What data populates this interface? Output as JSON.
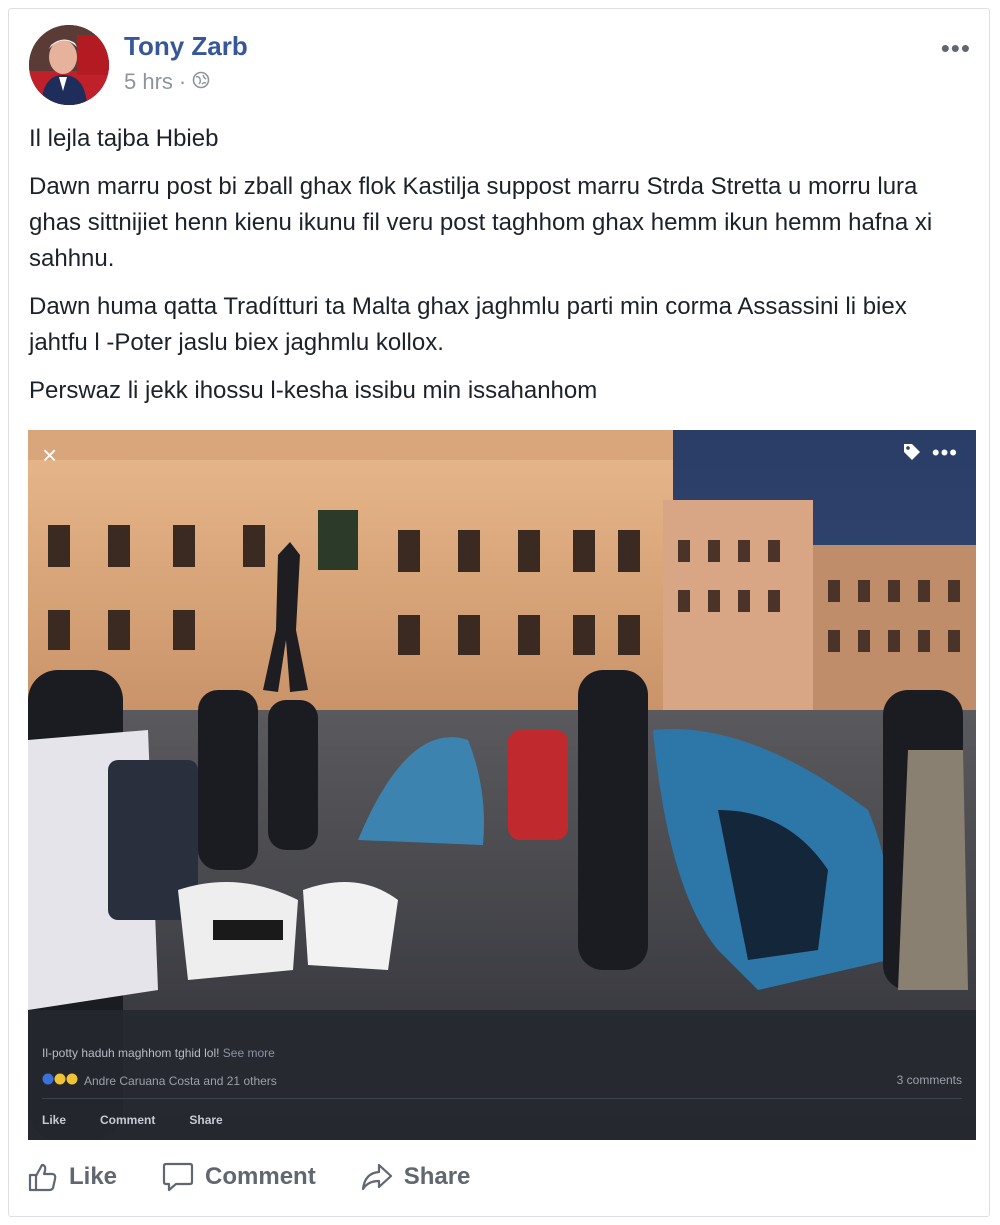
{
  "post": {
    "author": "Tony Zarb",
    "timestamp": "5 hrs",
    "separator": "·",
    "privacy_icon": "globe-icon",
    "more_label": "•••",
    "paragraphs": [
      "Il lejla tajba Hbieb",
      "Dawn marru post bi zball ghax flok Kastilja suppost marru Strda Stretta u morru lura ghas sittnijiet henn kienu ikunu fil veru post taghhom ghax hemm ikun hemm hafna xi sahhnu.",
      "Dawn huma qatta Tradítturi ta Malta ghax jaghmlu parti min corma Assassini li biex jahtfu l -Poter jaslu biex jaghmlu kollox.",
      "Perswaz li jekk ihossu l-kesha issibu min issahanhom"
    ]
  },
  "photo_overlay": {
    "close": "×",
    "more": "•••",
    "caption": "Il-potty haduh maghhom tghid lol!",
    "see_more": "See more",
    "reactions_text": "Andre Caruana Costa and 21 others",
    "comments_count": "3 comments",
    "actions": [
      "Like",
      "Comment",
      "Share"
    ]
  },
  "actions": {
    "like": "Like",
    "comment": "Comment",
    "share": "Share"
  },
  "colors": {
    "author_link": "#365899",
    "meta": "#90949c",
    "action_text": "#606770",
    "body_text": "#1d2129"
  }
}
